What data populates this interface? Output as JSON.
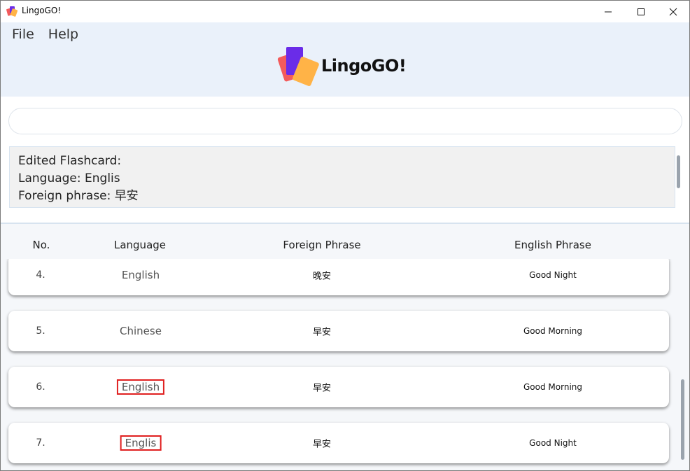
{
  "window": {
    "title": "LingoGO!",
    "minimize_icon": "minimize-icon",
    "maximize_icon": "maximize-icon",
    "close_icon": "close-icon"
  },
  "menu": {
    "items": [
      "File",
      "Help"
    ]
  },
  "logo": {
    "text": "LingoGO!",
    "colors": [
      "#f35b5b",
      "#6a2ce8",
      "#ffb347"
    ]
  },
  "command_box": {
    "value": "",
    "placeholder": ""
  },
  "result": {
    "lines": [
      "Edited Flashcard:",
      "Language: Englis",
      "Foreign phrase: 早安"
    ]
  },
  "table": {
    "headers": [
      "No.",
      "Language",
      "Foreign Phrase",
      "English Phrase"
    ],
    "rows": [
      {
        "no": "4.",
        "language": "English",
        "foreign": "晚安",
        "english": "Good Night",
        "highlight": false
      },
      {
        "no": "5.",
        "language": "Chinese",
        "foreign": "早安",
        "english": "Good Morning",
        "highlight": false
      },
      {
        "no": "6.",
        "language": "English",
        "foreign": "早安",
        "english": "Good Morning",
        "highlight": true
      },
      {
        "no": "7.",
        "language": "Englis",
        "foreign": "早安",
        "english": "Good Night",
        "highlight": true
      }
    ]
  },
  "colors": {
    "header_bg": "#eaf1fa",
    "highlight_border": "#e02020",
    "result_bg": "#f1f1f1"
  }
}
